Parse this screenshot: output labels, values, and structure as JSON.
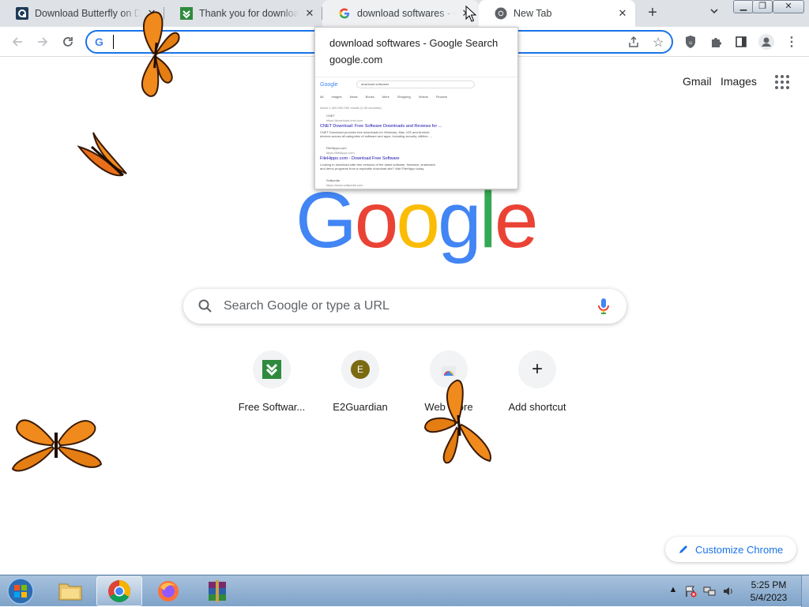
{
  "tabs": [
    {
      "title": "Download Butterfly on Desktop",
      "favicon": "qr-site-icon",
      "state": "inactive"
    },
    {
      "title": "Thank you for downloading",
      "favicon": "green-download-icon",
      "state": "inactive"
    },
    {
      "title": "download softwares - Google Search",
      "favicon": "google-g-icon",
      "state": "hover"
    },
    {
      "title": "New Tab",
      "favicon": "chrome-icon",
      "state": "active"
    }
  ],
  "hover_card": {
    "title": "download softwares - Google Search",
    "domain": "google.com",
    "preview": {
      "query": "download softwares",
      "filters": [
        "All",
        "Images",
        "News",
        "Books",
        "More",
        "Shopping",
        "Videos",
        "Finance"
      ],
      "stats": "About 1,490,000,000 results (0.46 seconds)",
      "results": [
        {
          "site": "CNET",
          "url": "https://download.cnet.com",
          "title": "CNET Download: Free Software Downloads and Reviews for ...",
          "snippet": "CNET Download provides free downloads for Windows, Mac, iOS and Android devices across all categories of software and apps, including security, utilities, ..."
        },
        {
          "site": "FileHippo.com",
          "url": "https://filehippo.com",
          "title": "FileHippo.com - Download Free Software",
          "snippet": "Looking to download safe free versions of the latest software, freeware, shareware and demo programs from a reputable download site? Visit FileHippo today."
        },
        {
          "site": "Softpedia",
          "url": "https://www.softpedia.com",
          "title": "",
          "snippet": ""
        }
      ]
    }
  },
  "omnibox": {
    "value": "",
    "placeholder": ""
  },
  "page": {
    "top_links": [
      "Gmail",
      "Images"
    ],
    "logo_letters": [
      {
        "char": "G",
        "color": "#4285f4"
      },
      {
        "char": "o",
        "color": "#ea4335"
      },
      {
        "char": "o",
        "color": "#fbbc05"
      },
      {
        "char": "g",
        "color": "#4285f4"
      },
      {
        "char": "l",
        "color": "#34a853"
      },
      {
        "char": "e",
        "color": "#ea4335"
      }
    ],
    "search_placeholder": "Search Google or type a URL",
    "shortcuts": [
      {
        "label": "Free Softwar...",
        "icon": "green-download-icon"
      },
      {
        "label": "E2Guardian",
        "icon": "letter-avatar",
        "letter": "E"
      },
      {
        "label": "Web Store",
        "icon": "chrome-web-store-icon"
      },
      {
        "label": "Add shortcut",
        "icon": "plus-icon"
      }
    ],
    "customize_label": "Customize Chrome"
  },
  "taskbar": {
    "apps": [
      "windows-explorer",
      "google-chrome",
      "firefox",
      "winrar"
    ],
    "active_app": "google-chrome",
    "clock_time": "5:25 PM",
    "clock_date": "5/4/2023"
  },
  "colors": {
    "accent": "#1a73e8",
    "tabstrip": "#dee1e6",
    "taskbar": "#8fb0d4",
    "butterfly": "#f08a1c"
  }
}
